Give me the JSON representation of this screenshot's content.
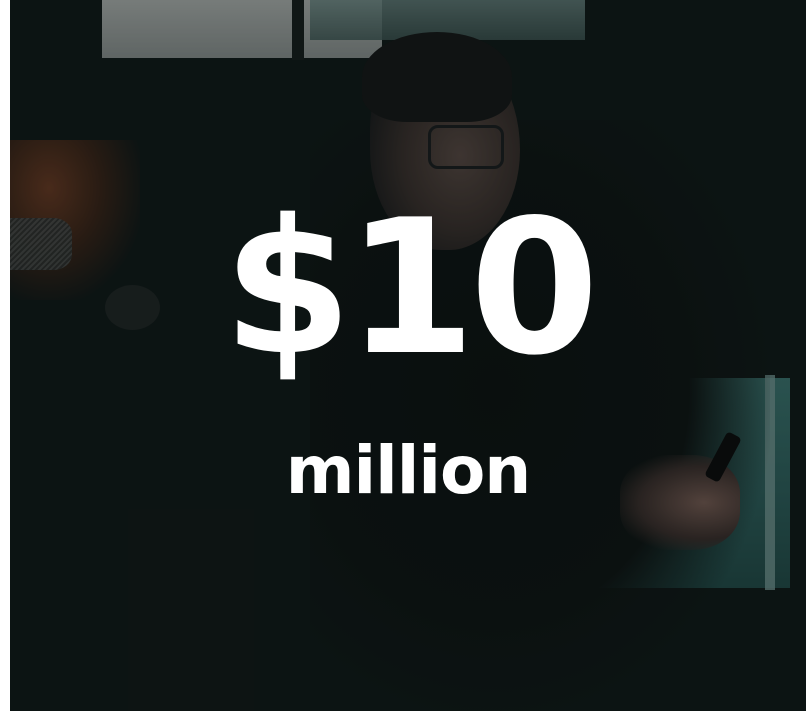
{
  "headline": {
    "amount": "$10",
    "unit": "million"
  },
  "colors": {
    "background": "#0f1716",
    "text": "#ffffff",
    "screen_accent": "#3f7c77"
  }
}
